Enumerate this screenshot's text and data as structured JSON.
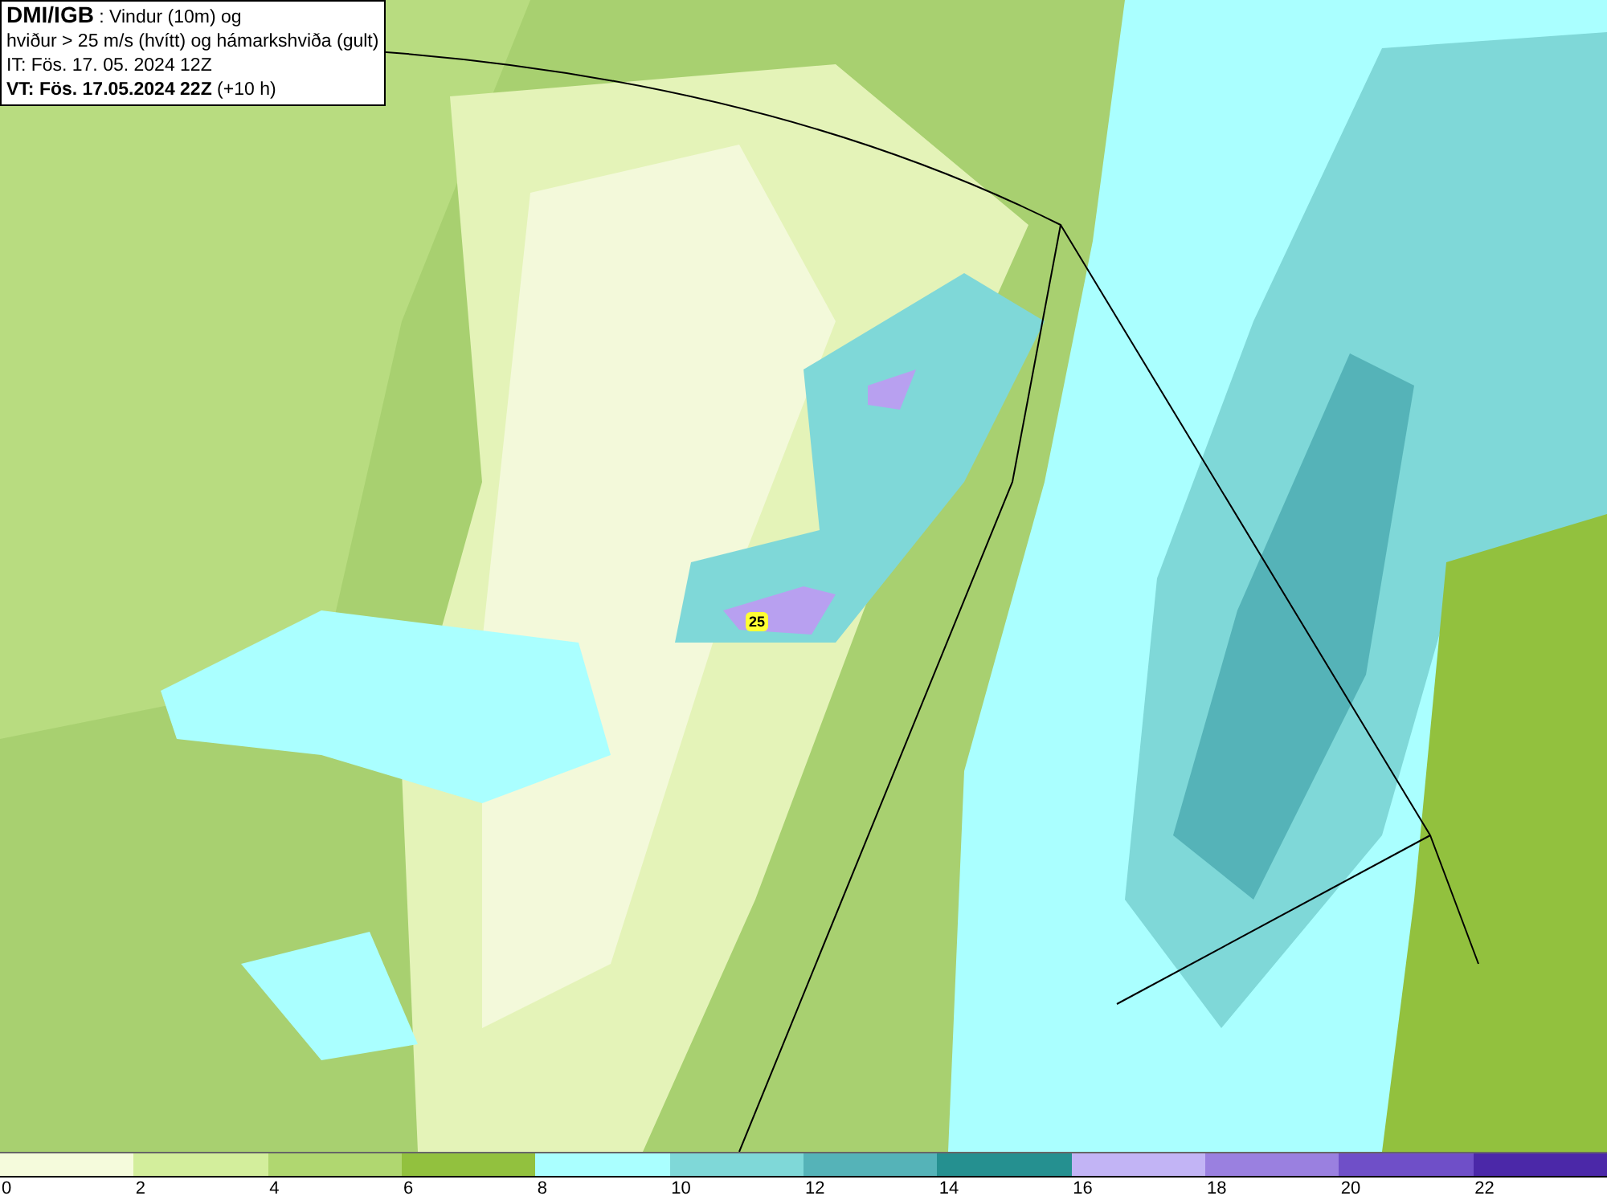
{
  "title_box": {
    "lines": [
      "**DMI/IGB** : Vindur (10m) og",
      "hviður > 25 m/s (hvítt) og hámarkshviða (gult)",
      "IT: Fös. 17. 05. 2024 12Z",
      "**VT: Fös. 17.05.2024 22Z** (+10 h)"
    ]
  },
  "map": {
    "gust_label": "25"
  },
  "legend": {
    "segments": [
      {
        "color": "#f5fbdc"
      },
      {
        "color": "#d3ee9c"
      },
      {
        "color": "#b0d770"
      },
      {
        "color": "#92c13e"
      },
      {
        "color": "#aaffff"
      },
      {
        "color": "#7fd8d8"
      },
      {
        "color": "#55b3b8"
      },
      {
        "color": "#259090"
      },
      {
        "color": "#c2b4f5"
      },
      {
        "color": "#9a80e0"
      },
      {
        "color": "#6f4fc8"
      },
      {
        "color": "#4b28a8"
      }
    ],
    "ticks": [
      "0",
      "2",
      "4",
      "6",
      "8",
      "10",
      "12",
      "14",
      "16",
      "18",
      "20",
      "22"
    ]
  }
}
